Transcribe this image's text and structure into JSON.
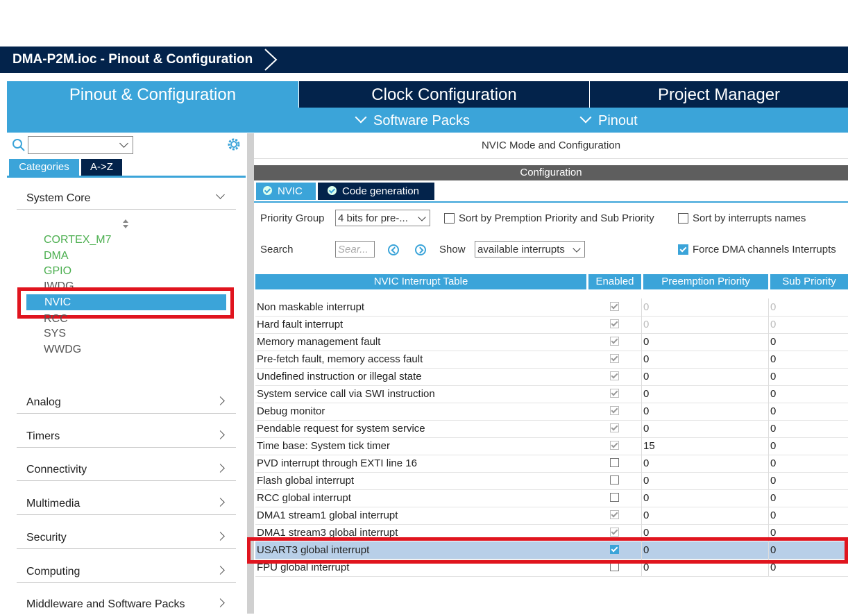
{
  "titlebar": {
    "crumb": "DMA-P2M.ioc - Pinout & Configuration"
  },
  "main_tabs": [
    "Pinout & Configuration",
    "Clock Configuration",
    "Project Manager"
  ],
  "sub_menu": [
    "Software Packs",
    "Pinout"
  ],
  "left": {
    "search_placeholder": "",
    "tabs": [
      "Categories",
      "A->Z"
    ],
    "categories": {
      "system_core": "System Core",
      "analog": "Analog",
      "timers": "Timers",
      "connectivity": "Connectivity",
      "multimedia": "Multimedia",
      "security": "Security",
      "computing": "Computing",
      "middleware": "Middleware and Software Packs"
    },
    "peripherals": [
      "CORTEX_M7",
      "DMA",
      "GPIO",
      "IWDG",
      "NVIC",
      "RCC",
      "SYS",
      "WWDG"
    ],
    "selected": "NVIC"
  },
  "right": {
    "header": "NVIC Mode and Configuration",
    "config_bar": "Configuration",
    "tabs": [
      "NVIC",
      "Code generation"
    ],
    "priority_group_label": "Priority Group",
    "priority_group_value": "4 bits for pre-...",
    "sort_preemption_label": "Sort by Premption Priority and Sub Priority",
    "sort_names_label": "Sort by interrupts names",
    "search_label": "Search",
    "search_placeholder": "Sear...",
    "show_label": "Show",
    "show_value": "available interrupts",
    "force_dma_label": "Force DMA channels Interrupts",
    "force_dma_checked": true
  },
  "table": {
    "headers": [
      "NVIC Interrupt Table",
      "Enabled",
      "Preemption Priority",
      "Sub Priority"
    ],
    "rows": [
      {
        "name": "Non maskable interrupt",
        "enabled": true,
        "pre": "0",
        "sub": "0",
        "locked": true,
        "dim": true
      },
      {
        "name": "Hard fault interrupt",
        "enabled": true,
        "pre": "0",
        "sub": "0",
        "locked": true,
        "dim": true
      },
      {
        "name": "Memory management fault",
        "enabled": true,
        "pre": "0",
        "sub": "0",
        "locked": true
      },
      {
        "name": "Pre-fetch fault, memory access fault",
        "enabled": true,
        "pre": "0",
        "sub": "0",
        "locked": true
      },
      {
        "name": "Undefined instruction or illegal state",
        "enabled": true,
        "pre": "0",
        "sub": "0",
        "locked": true
      },
      {
        "name": "System service call via SWI instruction",
        "enabled": true,
        "pre": "0",
        "sub": "0",
        "locked": true
      },
      {
        "name": "Debug monitor",
        "enabled": true,
        "pre": "0",
        "sub": "0",
        "locked": true
      },
      {
        "name": "Pendable request for system service",
        "enabled": true,
        "pre": "0",
        "sub": "0",
        "locked": true
      },
      {
        "name": "Time base: System tick timer",
        "enabled": true,
        "pre": "15",
        "sub": "0",
        "locked": true
      },
      {
        "name": "PVD interrupt through EXTI line 16",
        "enabled": false,
        "pre": "0",
        "sub": "0"
      },
      {
        "name": "Flash global interrupt",
        "enabled": false,
        "pre": "0",
        "sub": "0"
      },
      {
        "name": "RCC global interrupt",
        "enabled": false,
        "pre": "0",
        "sub": "0"
      },
      {
        "name": "DMA1 stream1 global interrupt",
        "enabled": true,
        "pre": "0",
        "sub": "0",
        "locked": true
      },
      {
        "name": "DMA1 stream3 global interrupt",
        "enabled": true,
        "pre": "0",
        "sub": "0",
        "locked": true
      },
      {
        "name": "USART3 global interrupt",
        "enabled": true,
        "pre": "0",
        "sub": "0",
        "selected": true
      },
      {
        "name": "FPU global interrupt",
        "enabled": false,
        "pre": "0",
        "sub": "0"
      }
    ]
  },
  "colors": {
    "accent": "#3ba4d9",
    "navy": "#03234b",
    "highlight": "#e0141e",
    "selected_row": "#b8cfe8"
  }
}
